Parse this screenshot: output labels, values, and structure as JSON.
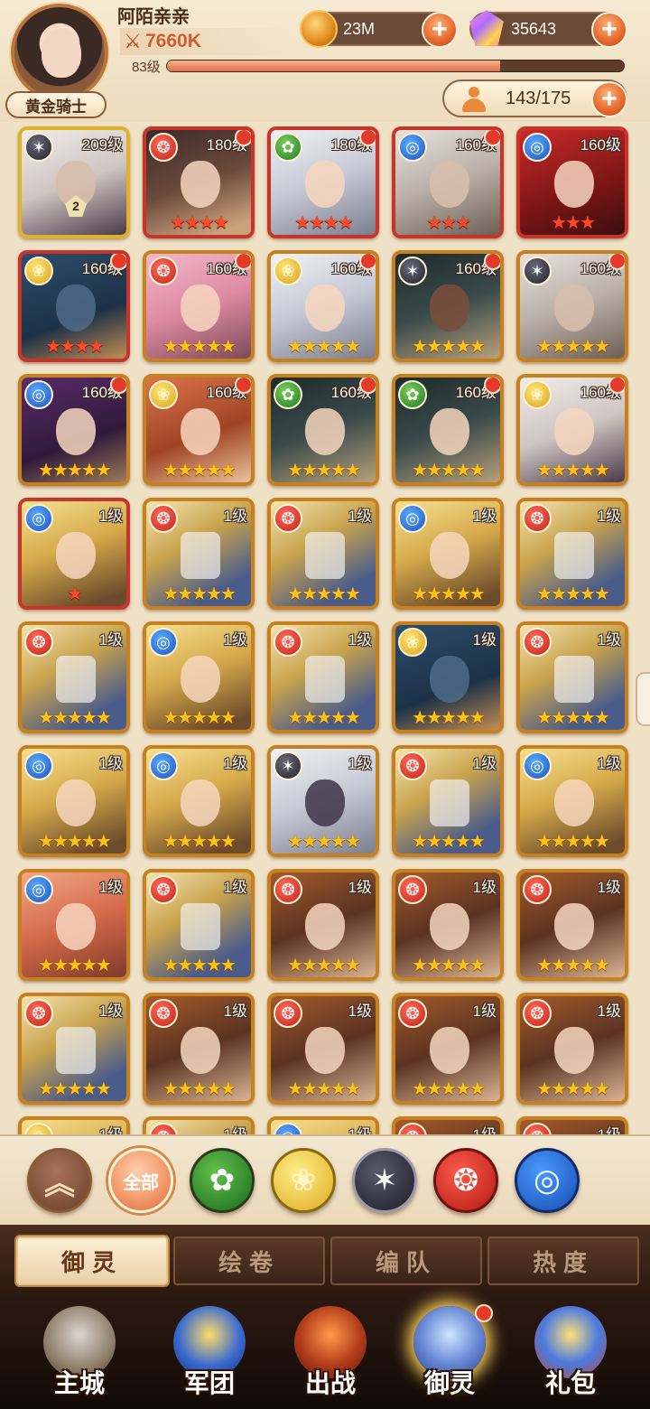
{
  "player": {
    "name": "阿陌亲亲",
    "power": "7660K",
    "level_label": "83级",
    "exp_progress": 0.73,
    "rank_title": "黄金骑士"
  },
  "resources": {
    "gold": "23M",
    "gems": "35643",
    "roster": "143/175"
  },
  "icons": {
    "power": "crossed-swords-icon",
    "gold": "gold-coin-icon",
    "gems": "gem-icon",
    "roster": "person-icon",
    "plus": "+"
  },
  "heroes": [
    {
      "level": "209级",
      "element": "shadow",
      "art": "ash",
      "face": "grey",
      "stars": 0,
      "star_color": "gold",
      "awaken": "2",
      "dot": false,
      "border": "gold-border"
    },
    {
      "level": "180级",
      "element": "fire",
      "art": "dark",
      "face": "",
      "stars": 4,
      "star_color": "red",
      "dot": true,
      "border": "red"
    },
    {
      "level": "180级",
      "element": "wood",
      "art": "white",
      "face": "",
      "stars": 4,
      "star_color": "red",
      "dot": true,
      "border": "red"
    },
    {
      "level": "160级",
      "element": "water",
      "art": "silver",
      "face": "grey",
      "stars": 3,
      "star_color": "red",
      "dot": true,
      "border": "red"
    },
    {
      "level": "160级",
      "element": "water",
      "art": "red",
      "face": "",
      "stars": 3,
      "star_color": "red",
      "dot": false,
      "border": "red"
    },
    {
      "level": "160级",
      "element": "light",
      "art": "blue",
      "face": "blue",
      "stars": 4,
      "star_color": "red",
      "dot": true,
      "border": "red"
    },
    {
      "level": "160级",
      "element": "fire",
      "art": "pink",
      "face": "",
      "stars": 5,
      "star_color": "gold",
      "dot": true,
      "border": ""
    },
    {
      "level": "160级",
      "element": "light",
      "art": "white",
      "face": "",
      "stars": 5,
      "star_color": "gold",
      "dot": true,
      "border": ""
    },
    {
      "level": "160级",
      "element": "shadow",
      "art": "black",
      "face": "dark",
      "stars": 5,
      "star_color": "gold",
      "dot": true,
      "border": ""
    },
    {
      "level": "160级",
      "element": "shadow",
      "art": "silver",
      "face": "grey",
      "stars": 5,
      "star_color": "gold",
      "dot": true,
      "border": ""
    },
    {
      "level": "160级",
      "element": "water",
      "art": "violet",
      "face": "",
      "stars": 5,
      "star_color": "gold",
      "dot": true,
      "border": ""
    },
    {
      "level": "160级",
      "element": "light",
      "art": "ginger",
      "face": "",
      "stars": 5,
      "star_color": "gold",
      "dot": true,
      "border": ""
    },
    {
      "level": "160级",
      "element": "wood",
      "art": "black",
      "face": "",
      "stars": 5,
      "star_color": "gold",
      "dot": true,
      "border": ""
    },
    {
      "level": "160级",
      "element": "wood",
      "art": "black",
      "face": "",
      "stars": 5,
      "star_color": "gold",
      "dot": true,
      "border": ""
    },
    {
      "level": "160级",
      "element": "light",
      "art": "ash",
      "face": "",
      "stars": 5,
      "star_color": "gold",
      "dot": true,
      "border": ""
    },
    {
      "level": "1级",
      "element": "water",
      "art": "blond",
      "face": "",
      "stars": 1,
      "star_color": "red",
      "dot": false,
      "border": "red"
    },
    {
      "level": "1级",
      "element": "fire",
      "art": "armor",
      "face": "helm",
      "stars": 5,
      "star_color": "gold",
      "dot": false,
      "border": ""
    },
    {
      "level": "1级",
      "element": "fire",
      "art": "armor",
      "face": "helm",
      "stars": 5,
      "star_color": "gold",
      "dot": false,
      "border": ""
    },
    {
      "level": "1级",
      "element": "water",
      "art": "blond",
      "face": "",
      "stars": 5,
      "star_color": "gold",
      "dot": false,
      "border": ""
    },
    {
      "level": "1级",
      "element": "fire",
      "art": "armor",
      "face": "helm",
      "stars": 5,
      "star_color": "gold",
      "dot": false,
      "border": ""
    },
    {
      "level": "1级",
      "element": "fire",
      "art": "armor",
      "face": "helm",
      "stars": 5,
      "star_color": "gold",
      "dot": false,
      "border": ""
    },
    {
      "level": "1级",
      "element": "water",
      "art": "blond",
      "face": "",
      "stars": 5,
      "star_color": "gold",
      "dot": false,
      "border": ""
    },
    {
      "level": "1级",
      "element": "fire",
      "art": "armor",
      "face": "helm",
      "stars": 5,
      "star_color": "gold",
      "dot": false,
      "border": ""
    },
    {
      "level": "1级",
      "element": "light",
      "art": "blue",
      "face": "blue",
      "stars": 5,
      "star_color": "gold",
      "dot": false,
      "border": ""
    },
    {
      "level": "1级",
      "element": "fire",
      "art": "armor",
      "face": "helm",
      "stars": 5,
      "star_color": "gold",
      "dot": false,
      "border": ""
    },
    {
      "level": "1级",
      "element": "water",
      "art": "blond",
      "face": "",
      "stars": 5,
      "star_color": "gold",
      "dot": false,
      "border": ""
    },
    {
      "level": "1级",
      "element": "water",
      "art": "blond",
      "face": "",
      "stars": 5,
      "star_color": "gold",
      "dot": false,
      "border": ""
    },
    {
      "level": "1级",
      "element": "shadow",
      "art": "white",
      "face": "purple",
      "stars": 5,
      "star_color": "gold",
      "dot": false,
      "border": ""
    },
    {
      "level": "1级",
      "element": "fire",
      "art": "armor",
      "face": "helm",
      "stars": 5,
      "star_color": "gold",
      "dot": false,
      "border": ""
    },
    {
      "level": "1级",
      "element": "water",
      "art": "blond",
      "face": "",
      "stars": 5,
      "star_color": "gold",
      "dot": false,
      "border": ""
    },
    {
      "level": "1级",
      "element": "water",
      "art": "coral",
      "face": "",
      "stars": 5,
      "star_color": "gold",
      "dot": false,
      "border": ""
    },
    {
      "level": "1级",
      "element": "fire",
      "art": "armor",
      "face": "helm",
      "stars": 5,
      "star_color": "gold",
      "dot": false,
      "border": ""
    },
    {
      "level": "1级",
      "element": "fire",
      "art": "warrior",
      "face": "",
      "stars": 5,
      "star_color": "gold",
      "dot": false,
      "border": ""
    },
    {
      "level": "1级",
      "element": "fire",
      "art": "warrior",
      "face": "",
      "stars": 5,
      "star_color": "gold",
      "dot": false,
      "border": ""
    },
    {
      "level": "1级",
      "element": "fire",
      "art": "warrior",
      "face": "",
      "stars": 5,
      "star_color": "gold",
      "dot": false,
      "border": ""
    },
    {
      "level": "1级",
      "element": "fire",
      "art": "armor",
      "face": "helm",
      "stars": 5,
      "star_color": "gold",
      "dot": false,
      "border": ""
    },
    {
      "level": "1级",
      "element": "fire",
      "art": "warrior",
      "face": "",
      "stars": 5,
      "star_color": "gold",
      "dot": false,
      "border": ""
    },
    {
      "level": "1级",
      "element": "fire",
      "art": "warrior",
      "face": "",
      "stars": 5,
      "star_color": "gold",
      "dot": false,
      "border": ""
    },
    {
      "level": "1级",
      "element": "fire",
      "art": "warrior",
      "face": "",
      "stars": 5,
      "star_color": "gold",
      "dot": false,
      "border": ""
    },
    {
      "level": "1级",
      "element": "fire",
      "art": "warrior",
      "face": "",
      "stars": 5,
      "star_color": "gold",
      "dot": false,
      "border": ""
    },
    {
      "level": "1级",
      "element": "light",
      "art": "blond",
      "face": "",
      "stars": 0,
      "star_color": "gold",
      "dot": false,
      "border": ""
    },
    {
      "level": "1级",
      "element": "fire",
      "art": "armor",
      "face": "",
      "stars": 0,
      "star_color": "gold",
      "dot": false,
      "border": ""
    },
    {
      "level": "1级",
      "element": "water",
      "art": "blond",
      "face": "",
      "stars": 0,
      "star_color": "gold",
      "dot": false,
      "border": ""
    },
    {
      "level": "1级",
      "element": "fire",
      "art": "warrior",
      "face": "",
      "stars": 0,
      "star_color": "gold",
      "dot": false,
      "border": ""
    },
    {
      "level": "1级",
      "element": "fire",
      "art": "warrior",
      "face": "",
      "stars": 0,
      "star_color": "gold",
      "dot": false,
      "border": ""
    }
  ],
  "filters": [
    {
      "kind": "up",
      "label": "︽",
      "icon": "double-chevron-up-icon"
    },
    {
      "kind": "all",
      "label": "全部",
      "icon": "all-filter"
    },
    {
      "kind": "wood",
      "label": "",
      "icon": "wood-element-icon"
    },
    {
      "kind": "light",
      "label": "",
      "icon": "light-element-icon"
    },
    {
      "kind": "shadow",
      "label": "",
      "icon": "shadow-element-icon"
    },
    {
      "kind": "fire",
      "label": "",
      "icon": "fire-element-icon"
    },
    {
      "kind": "water",
      "label": "",
      "icon": "water-element-icon"
    }
  ],
  "subtabs": [
    {
      "label": "御灵",
      "active": true
    },
    {
      "label": "绘卷",
      "active": false
    },
    {
      "label": "编队",
      "active": false
    },
    {
      "label": "热度",
      "active": false
    }
  ],
  "nav": [
    {
      "label": "主城",
      "icon": "city-icon",
      "cls": "ic-city",
      "active": false,
      "dot": false
    },
    {
      "label": "军团",
      "icon": "legion-shield-icon",
      "cls": "ic-legion",
      "active": false,
      "dot": false
    },
    {
      "label": "出战",
      "icon": "battle-gate-icon",
      "cls": "ic-battle",
      "active": false,
      "dot": false
    },
    {
      "label": "御灵",
      "icon": "spirit-crystal-icon",
      "cls": "ic-spirit",
      "active": true,
      "dot": true
    },
    {
      "label": "礼包",
      "icon": "gift-shop-icon",
      "cls": "ic-gift",
      "active": false,
      "dot": false
    }
  ],
  "colors": {
    "accent": "#e5672c",
    "frame_gold": "#c7801f",
    "frame_red": "#c7342a",
    "notify_red": "#e33a2a"
  }
}
